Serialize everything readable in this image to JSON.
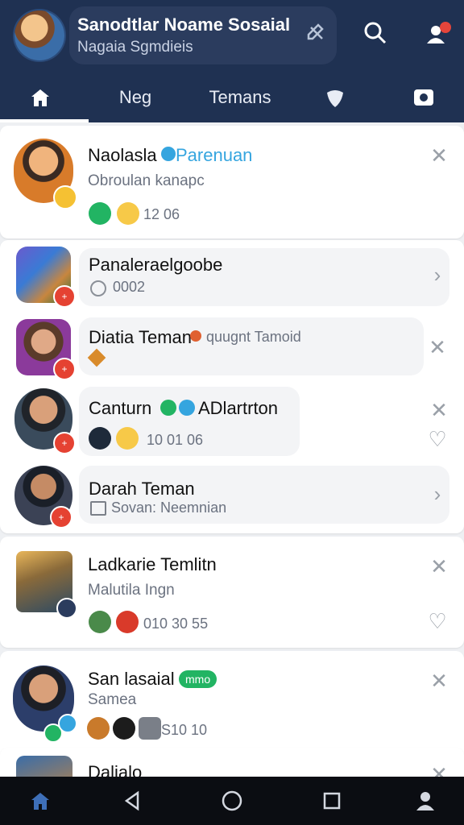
{
  "header": {
    "title": "Sanodtlar Noame Sosaial",
    "subtitle": "Nagaia Sgmdieis"
  },
  "tabs": [
    {
      "label": "",
      "icon": "home-icon"
    },
    {
      "label": "Neg"
    },
    {
      "label": "Temans"
    },
    {
      "label": "",
      "icon": "shield-icon"
    },
    {
      "label": "",
      "icon": "camera-icon"
    }
  ],
  "feed": {
    "items": [
      {
        "name": "Naolasla",
        "tag": "Parenuan",
        "subtitle": "Obroulan kanapc",
        "meta": "12 06"
      },
      {
        "name": "Panaleraelgoobe",
        "meta": "0002"
      },
      {
        "name": "Diatia Teman",
        "extra": "quugnt Tamoid"
      },
      {
        "name": "Canturn",
        "suffix": "ADlartrton",
        "meta": "10 01 06"
      },
      {
        "name": "Darah Teman",
        "subtitle": "Sovan: Neemnian"
      },
      {
        "name": "Ladkarie Temlitn",
        "subtitle": "Malutila Ingn",
        "meta": "010 30 55"
      },
      {
        "name": "San lasaial",
        "chip": "mmo",
        "subtitle": "Samea",
        "meta": "S10 10"
      },
      {
        "name": "Dalialo"
      }
    ]
  },
  "colors": {
    "header_bg": "#1f3152",
    "notify_dot": "#e5453b",
    "verified_blue": "#35a5df",
    "online_green": "#22b463"
  }
}
